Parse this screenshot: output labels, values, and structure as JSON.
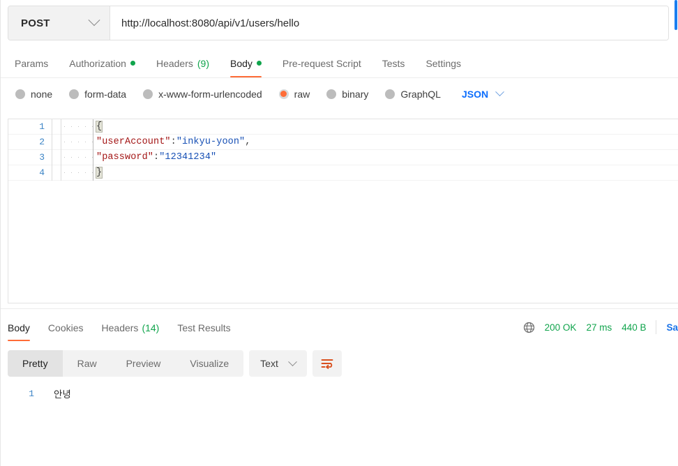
{
  "request": {
    "method": "POST",
    "url": "http://localhost:8080/api/v1/users/hello",
    "tabs": [
      {
        "label": "Params",
        "active": false,
        "dot": false,
        "count": ""
      },
      {
        "label": "Authorization",
        "active": false,
        "dot": true,
        "count": ""
      },
      {
        "label": "Headers",
        "active": false,
        "dot": false,
        "count": "(9)"
      },
      {
        "label": "Body",
        "active": true,
        "dot": true,
        "count": ""
      },
      {
        "label": "Pre-request Script",
        "active": false,
        "dot": false,
        "count": ""
      },
      {
        "label": "Tests",
        "active": false,
        "dot": false,
        "count": ""
      },
      {
        "label": "Settings",
        "active": false,
        "dot": false,
        "count": ""
      }
    ],
    "body_types": [
      {
        "label": "none",
        "selected": false
      },
      {
        "label": "form-data",
        "selected": false
      },
      {
        "label": "x-www-form-urlencoded",
        "selected": false
      },
      {
        "label": "raw",
        "selected": true
      },
      {
        "label": "binary",
        "selected": false
      },
      {
        "label": "GraphQL",
        "selected": false
      }
    ],
    "raw_format": "JSON",
    "body_lines": [
      {
        "num": "1",
        "open_brace": "{"
      },
      {
        "num": "2",
        "key": "\"userAccount\"",
        "colon": ":",
        "value": "\"inkyu-yoon\"",
        "comma": ","
      },
      {
        "num": "3",
        "key": "\"password\"",
        "colon": ":",
        "value": "\"12341234\"",
        "comma": ""
      },
      {
        "num": "4",
        "close_brace": "}"
      }
    ]
  },
  "response": {
    "tabs": [
      {
        "label": "Body",
        "active": true,
        "count": ""
      },
      {
        "label": "Cookies",
        "active": false,
        "count": ""
      },
      {
        "label": "Headers",
        "active": false,
        "count": "(14)"
      },
      {
        "label": "Test Results",
        "active": false,
        "count": ""
      }
    ],
    "status_code": "200 OK",
    "time": "27 ms",
    "size": "440 B",
    "save_label": "Sa",
    "view_modes": [
      {
        "label": "Pretty",
        "active": true
      },
      {
        "label": "Raw",
        "active": false
      },
      {
        "label": "Preview",
        "active": false
      },
      {
        "label": "Visualize",
        "active": false
      }
    ],
    "format": "Text",
    "body_lines": [
      {
        "num": "1",
        "text": "안녕"
      }
    ]
  },
  "colors": {
    "accent": "#ff6c37",
    "green": "#10a44c",
    "blue": "#0d6efd",
    "linenum": "#3d85c6"
  }
}
